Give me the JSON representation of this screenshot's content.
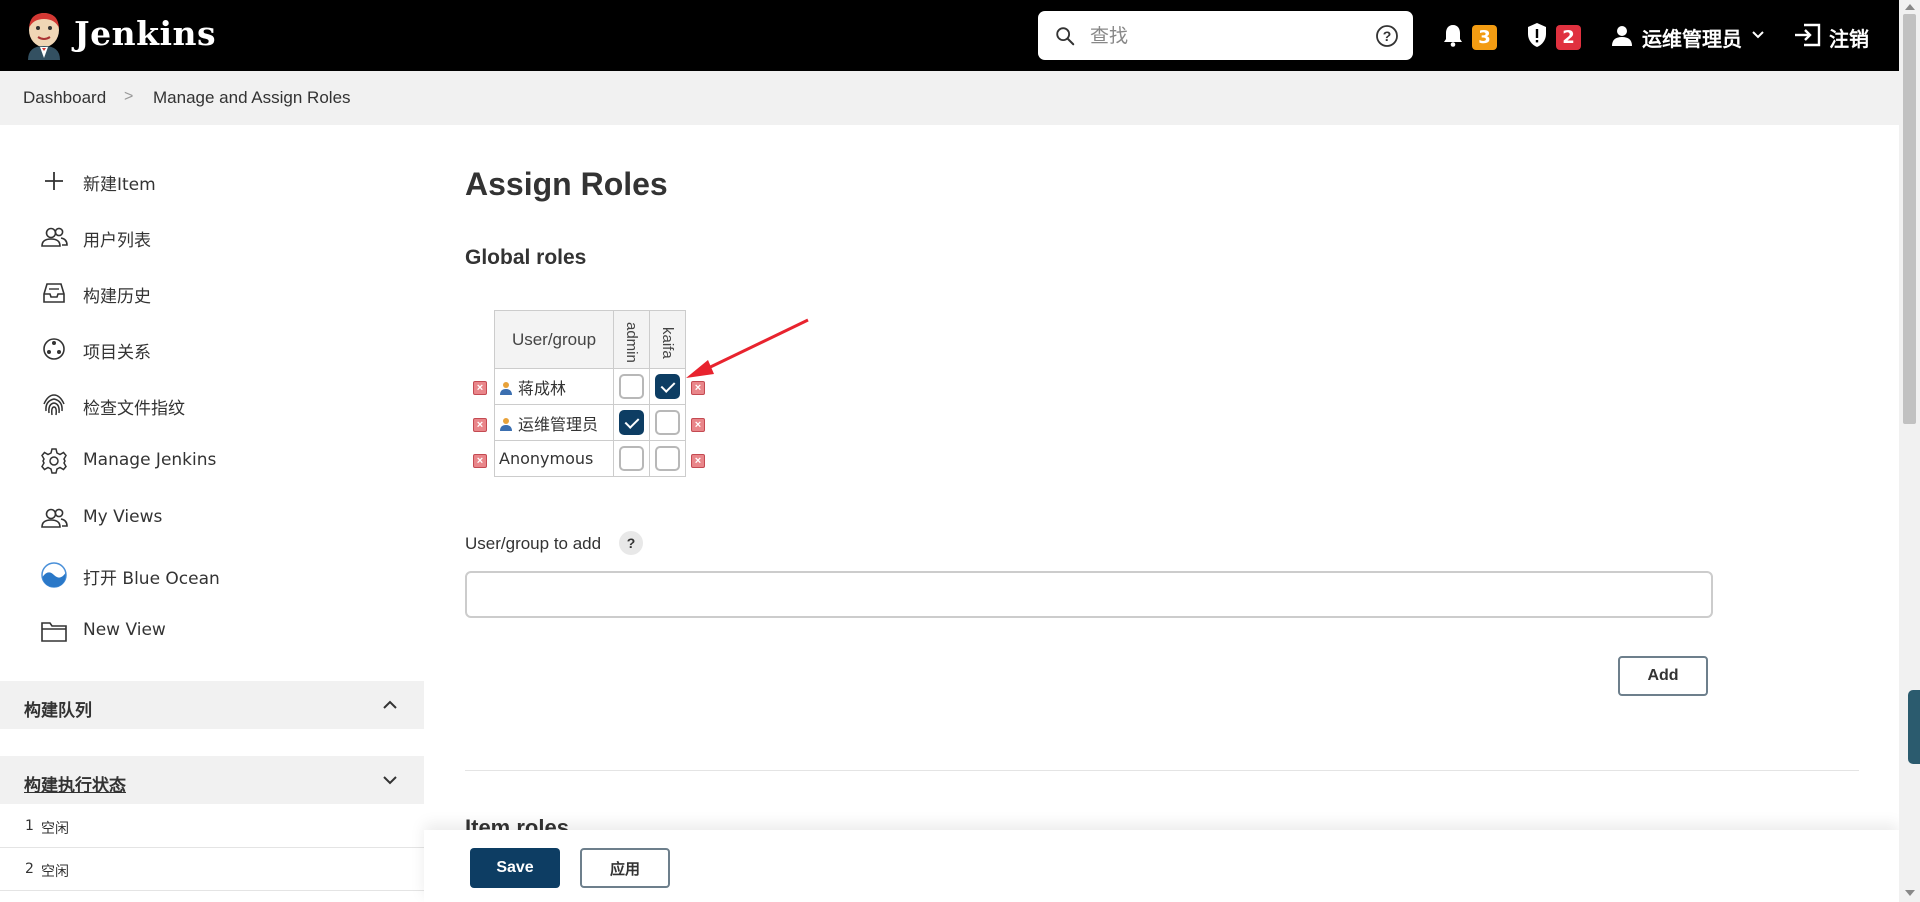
{
  "header": {
    "brand": "Jenkins",
    "search_placeholder": "查找",
    "notifications_count": "3",
    "security_count": "2",
    "user_name": "运维管理员",
    "logout_label": "注销",
    "colors": {
      "bg": "#000000",
      "notif_badge": "#f39c12",
      "security_badge": "#e0313f"
    }
  },
  "breadcrumb": {
    "items": [
      "Dashboard",
      "Manage and Assign Roles"
    ],
    "separator": ">"
  },
  "sidebar": {
    "items": [
      {
        "label": "新建Item",
        "icon": "plus-icon"
      },
      {
        "label": "用户列表",
        "icon": "people-icon"
      },
      {
        "label": "构建历史",
        "icon": "inbox-icon"
      },
      {
        "label": "项目关系",
        "icon": "relationship-icon"
      },
      {
        "label": "检查文件指纹",
        "icon": "fingerprint-icon"
      },
      {
        "label": "Manage Jenkins",
        "icon": "gear-icon"
      },
      {
        "label": "My Views",
        "icon": "people-icon"
      },
      {
        "label": "打开 Blue Ocean",
        "icon": "blue-ocean-icon"
      },
      {
        "label": "New View",
        "icon": "folder-icon"
      }
    ],
    "build_queue": {
      "title": "构建队列",
      "expanded": true
    },
    "executor_status": {
      "title": "构建执行状态",
      "executors": [
        {
          "num": "1",
          "status": "空闲"
        },
        {
          "num": "2",
          "status": "空闲"
        }
      ]
    }
  },
  "main": {
    "title": "Assign Roles",
    "global_roles_title": "Global roles",
    "table": {
      "header": "User/group",
      "roles": [
        "admin",
        "kaifa"
      ],
      "rows": [
        {
          "name": "蒋成林",
          "user_icon": true,
          "checks": [
            false,
            true
          ]
        },
        {
          "name": "运维管理员",
          "user_icon": true,
          "checks": [
            true,
            false
          ]
        },
        {
          "name": "Anonymous",
          "user_icon": false,
          "checks": [
            false,
            false
          ]
        }
      ]
    },
    "add_label": "User/group to add",
    "add_help": "?",
    "add_input_value": "",
    "add_button": "Add",
    "item_roles_title": "Item roles",
    "save_button": "Save",
    "apply_button": "应用",
    "accent_color": "#0d3d63"
  }
}
